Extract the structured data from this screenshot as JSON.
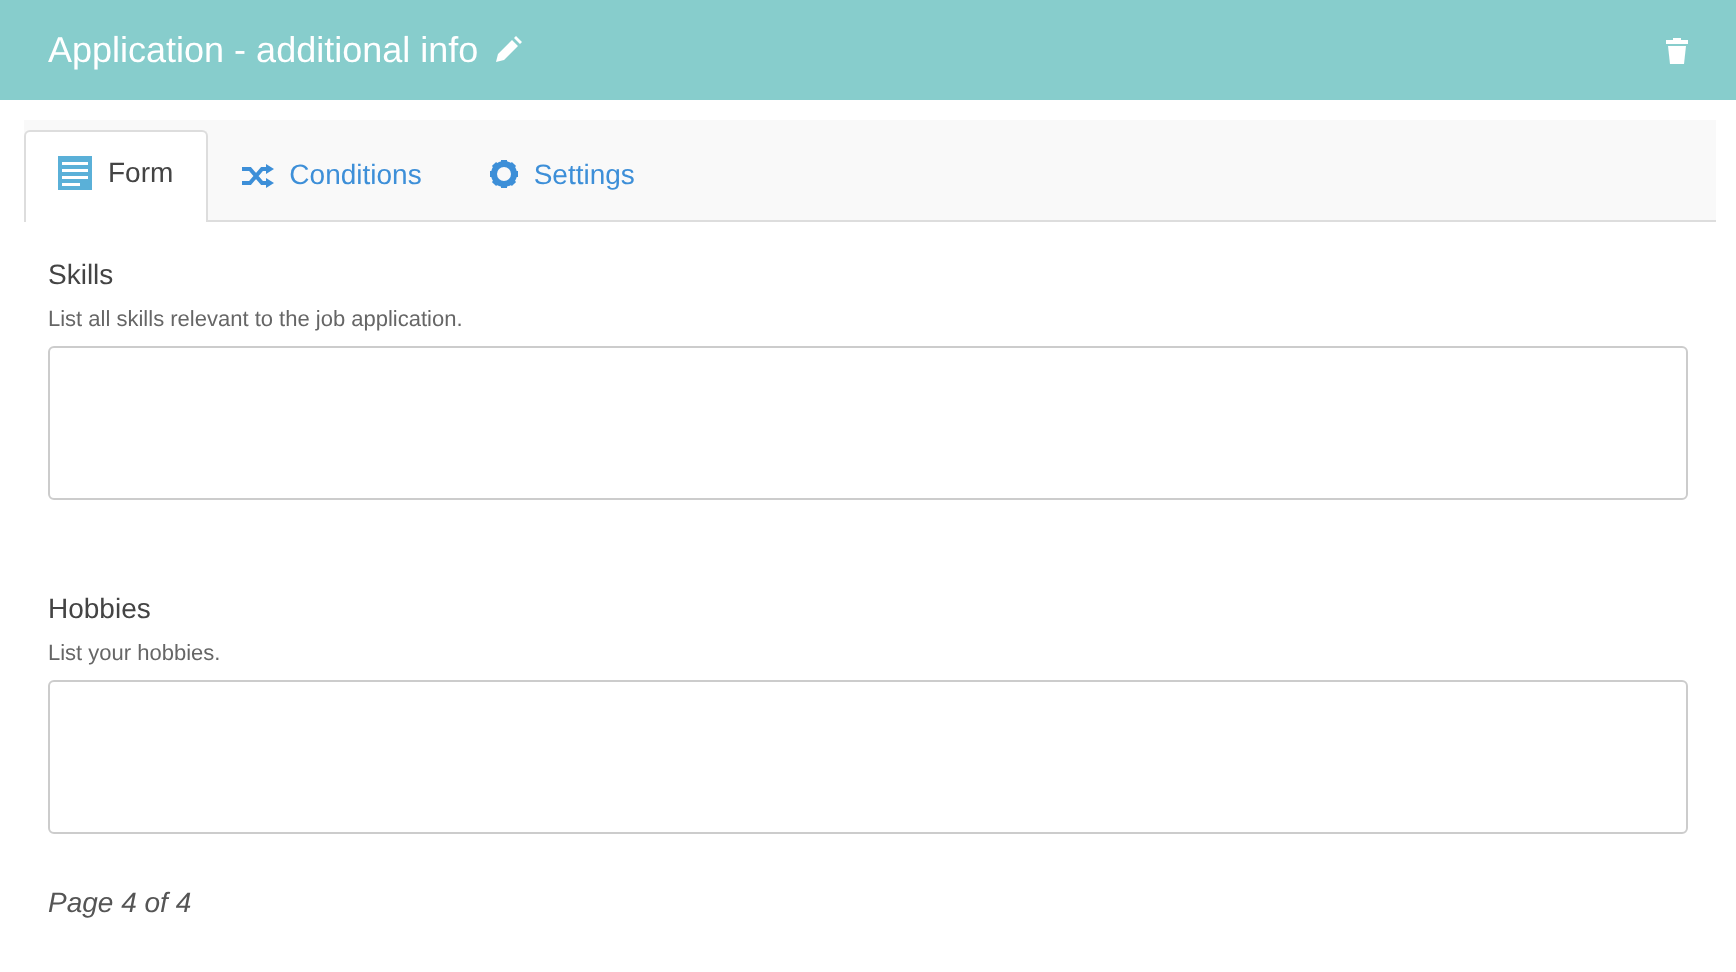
{
  "header": {
    "title": "Application - additional info"
  },
  "tabs": [
    {
      "label": "Form",
      "kind": "form",
      "selected": true
    },
    {
      "label": "Conditions",
      "kind": "conditions",
      "selected": false
    },
    {
      "label": "Settings",
      "kind": "settings",
      "selected": false
    }
  ],
  "fields": [
    {
      "label": "Skills",
      "help": "List all skills relevant to the job application."
    },
    {
      "label": "Hobbies",
      "help": "List your hobbies."
    }
  ],
  "footer": {
    "page": "Page 4 of 4"
  }
}
